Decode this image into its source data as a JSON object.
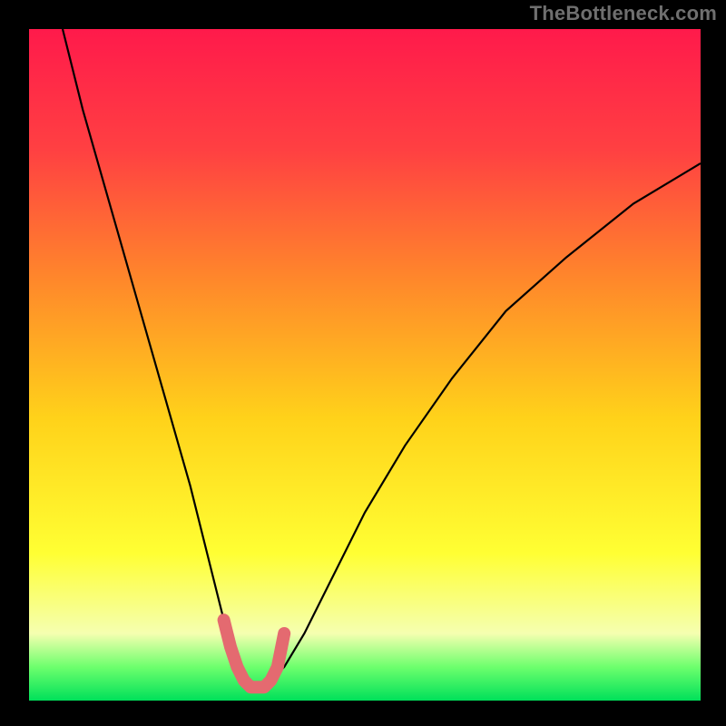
{
  "watermark": "TheBottleneck.com",
  "colors": {
    "gradient_stops": [
      {
        "offset": "0%",
        "color": "#ff1a4b"
      },
      {
        "offset": "18%",
        "color": "#ff4042"
      },
      {
        "offset": "38%",
        "color": "#ff8a2a"
      },
      {
        "offset": "58%",
        "color": "#ffd21a"
      },
      {
        "offset": "78%",
        "color": "#ffff33"
      },
      {
        "offset": "90%",
        "color": "#f5ffb0"
      },
      {
        "offset": "95%",
        "color": "#6dff6d"
      },
      {
        "offset": "100%",
        "color": "#00e05a"
      }
    ],
    "curve_stroke": "#000000",
    "marker_stroke": "#e46a70"
  },
  "chart_data": {
    "type": "line",
    "title": "",
    "xlabel": "",
    "ylabel": "",
    "xlim": [
      0,
      100
    ],
    "ylim": [
      0,
      100
    ],
    "grid": false,
    "legend": false,
    "series": [
      {
        "name": "bottleneck-curve",
        "x": [
          5,
          8,
          12,
          16,
          20,
          24,
          27,
          29,
          30,
          31,
          32,
          33,
          34,
          35,
          36,
          38,
          41,
          45,
          50,
          56,
          63,
          71,
          80,
          90,
          100
        ],
        "y": [
          100,
          88,
          74,
          60,
          46,
          32,
          20,
          12,
          8,
          5,
          3,
          2,
          2,
          2,
          3,
          5,
          10,
          18,
          28,
          38,
          48,
          58,
          66,
          74,
          80
        ]
      }
    ],
    "annotations": [
      {
        "name": "highlight-near-minimum",
        "x": [
          29,
          30,
          31,
          32,
          33,
          34,
          35,
          36,
          37,
          38
        ],
        "y": [
          12,
          8,
          5,
          3,
          2,
          2,
          2,
          3,
          5,
          10
        ]
      }
    ]
  }
}
